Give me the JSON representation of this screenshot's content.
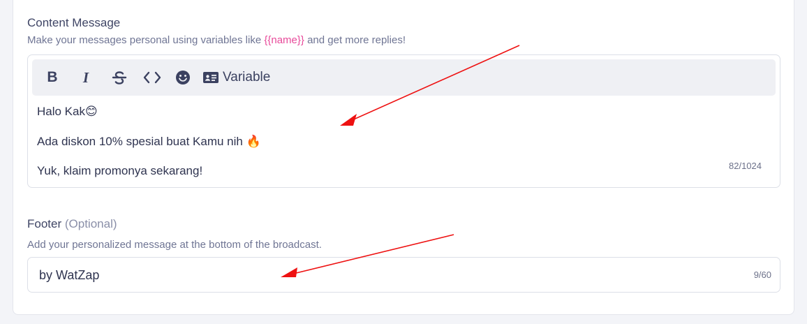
{
  "content_message": {
    "label": "Content Message",
    "hint_before": "Make your messages personal using variables like ",
    "hint_variable": "{{name}}",
    "hint_after": " and get more replies!",
    "toolbar": {
      "bold_icon": "B",
      "italic_icon": "I",
      "variable_label": "Variable"
    },
    "lines": [
      "Halo Kak😊",
      "Ada diskon 10% spesial buat Kamu nih 🔥",
      "Yuk, klaim promonya sekarang!"
    ],
    "counter": "82/1024"
  },
  "footer": {
    "label": "Footer",
    "optional": "(Optional)",
    "hint": "Add your personalized message at the bottom of the broadcast.",
    "value": "by WatZap",
    "counter": "9/60"
  },
  "colors": {
    "variable_highlight": "#e84a9a",
    "arrow": "#ee1111"
  }
}
